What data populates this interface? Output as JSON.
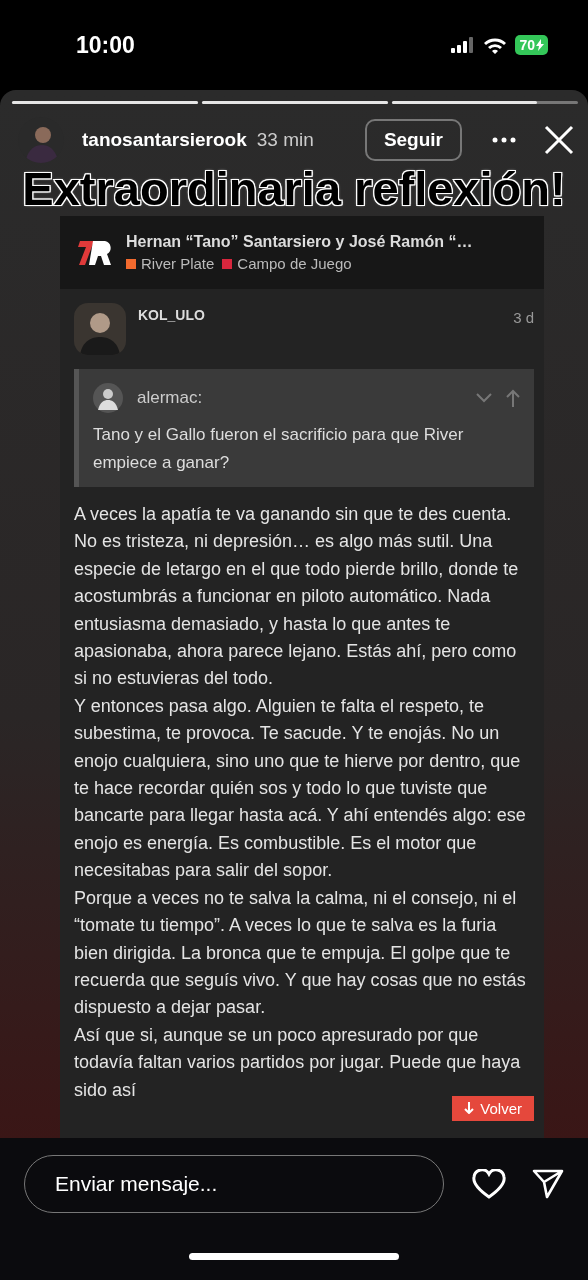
{
  "status_bar": {
    "time": "10:00",
    "battery": "70"
  },
  "story": {
    "progress": [
      {
        "level": 1
      },
      {
        "level": 1
      },
      {
        "level": 0.78
      }
    ],
    "username": "tanosantarsierook",
    "time": "33 min",
    "follow_button": "Seguir",
    "caption": "Extraordinaria reflexión!",
    "forum": {
      "title": "Hernan “Tano” Santarsiero y José Ramón “…",
      "categories": [
        {
          "name": "River Plate",
          "color": "#f26a2e"
        },
        {
          "name": "Campo de Juego",
          "color": "#d7263d"
        }
      ],
      "post": {
        "author": "KOL_ULO",
        "age": "3 d",
        "quote": {
          "author": "alermac:",
          "text": "Tano y el Gallo fueron el sacrificio para que River empiece a ganar?"
        },
        "paragraphs": [
          "A veces la apatía te va ganando sin que te des cuenta. No es tristeza, ni depresión… es algo más sutil. Una especie de letargo en el que todo pierde brillo, donde te acostumbrás a funcionar en piloto automático. Nada entusiasma demasiado, y hasta lo que antes te apasionaba, ahora parece lejano. Estás ahí, pero como si no estuvieras del todo.",
          "Y entonces pasa algo. Alguien te falta el respeto, te subestima, te provoca. Te sacude. Y te enojás. No un enojo cualquiera, sino uno que te hierve por dentro, que te hace recordar quién sos y todo lo que tuviste que bancarte para llegar hasta acá. Y ahí entendés algo: ese enojo es energía. Es combustible. Es el motor que necesitabas para salir del sopor.",
          "Porque a veces no te salva la calma, ni el consejo, ni el “tomate tu tiempo”. A veces lo que te salva es la furia bien dirigida. La bronca que te empuja. El golpe que te recuerda que seguís vivo. Y que hay cosas que no estás dispuesto a dejar pasar.",
          "Así que si, aunque se un poco apresurado por que todavía faltan varios partidos por jugar. Puede que haya sido así"
        ],
        "back_button": "Volver"
      }
    }
  },
  "reply_bar": {
    "placeholder": "Enviar mensaje..."
  }
}
